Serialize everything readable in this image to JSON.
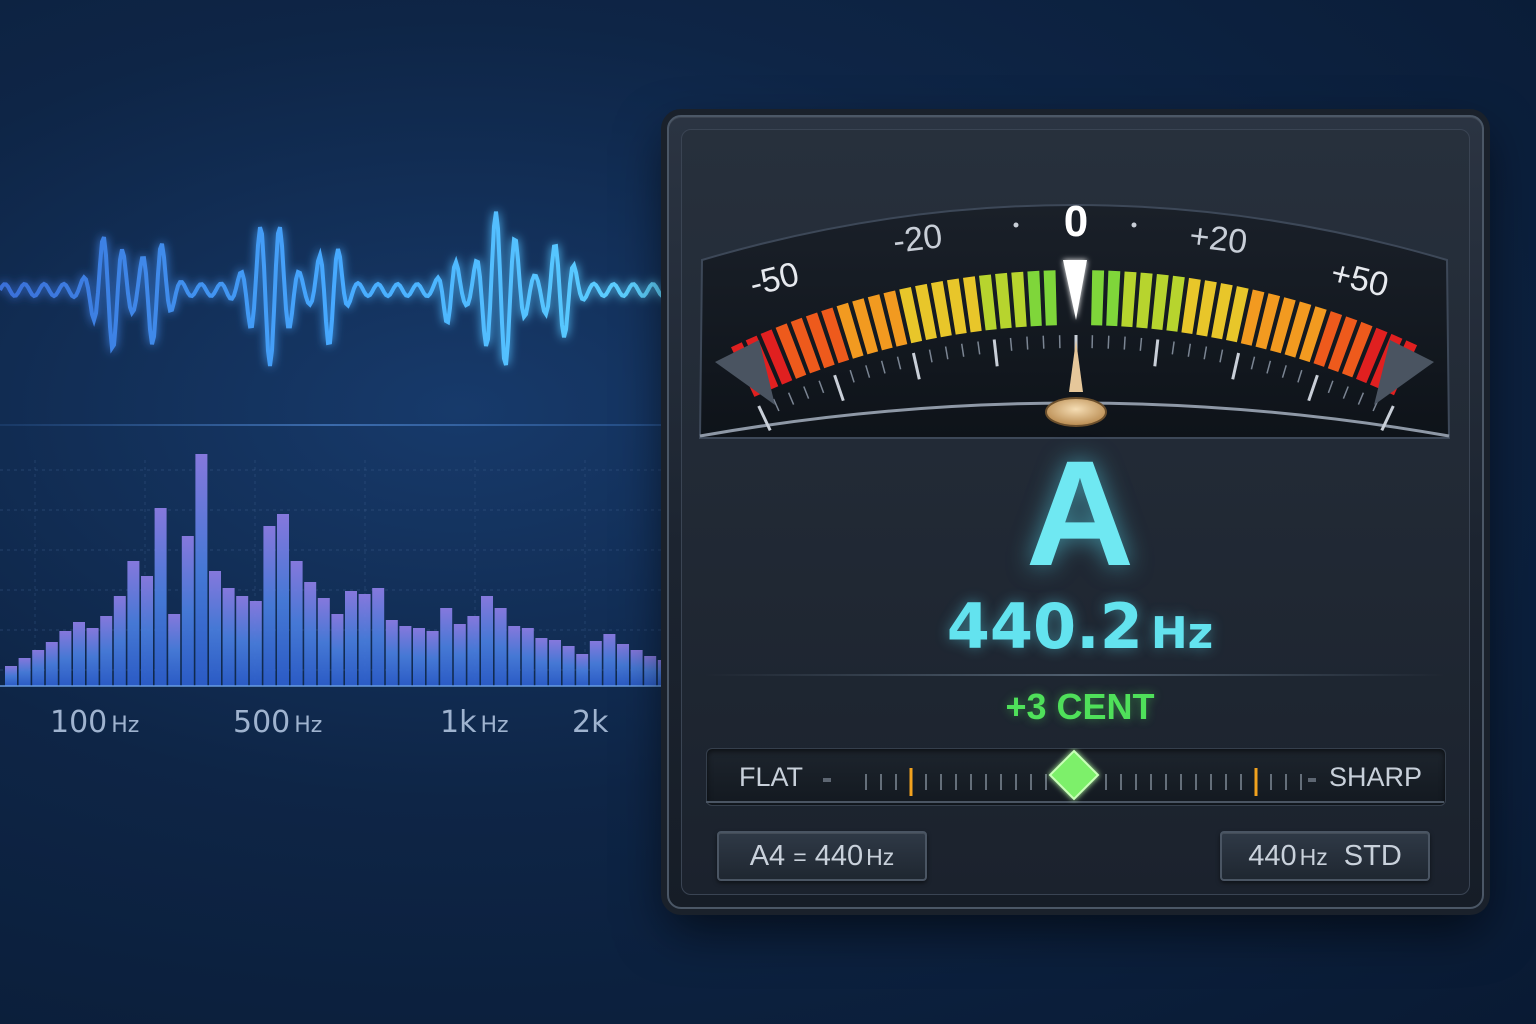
{
  "spectrum": {
    "labels": [
      {
        "value": "100",
        "unit": "Hz"
      },
      {
        "value": "500",
        "unit": "Hz"
      },
      {
        "value": "1k",
        "unit": "Hz"
      },
      {
        "value": "2k",
        "unit": ""
      }
    ]
  },
  "tuner": {
    "scale_labels": [
      "-50",
      "-20",
      "0",
      "+20",
      "+50"
    ],
    "note": "A",
    "frequency": "440.2",
    "frequency_unit": "Hz",
    "cents": "+3 CENT",
    "cents_value": 3,
    "flat_label": "FLAT",
    "sharp_label": "SHARP",
    "reference_button": {
      "note": "A4",
      "eq": "=",
      "value": "440",
      "unit": "Hz"
    },
    "standard_button": {
      "value": "440",
      "unit": "Hz",
      "suffix": "STD"
    }
  },
  "colors": {
    "note": "#6fe8f2",
    "cents": "#4fe05a",
    "needle": "#e6c79a",
    "waveform": "#4fb3ff"
  }
}
